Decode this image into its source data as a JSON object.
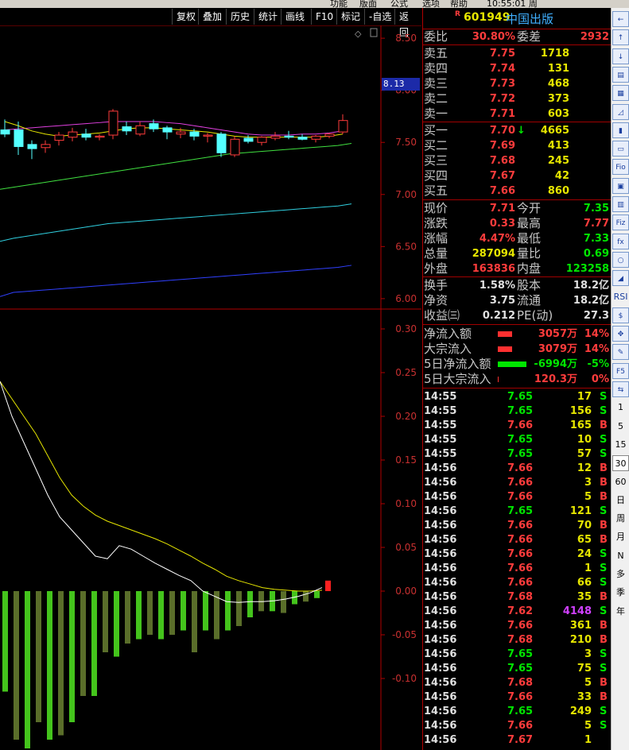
{
  "top_menu": [
    "功能",
    "版面",
    "公式",
    "选项",
    "帮助",
    "10:55:01 周"
  ],
  "toolbar": [
    {
      "label": "复权"
    },
    {
      "label": "叠加"
    },
    {
      "label": "历史"
    },
    {
      "label": "统计"
    },
    {
      "label": "画线"
    },
    {
      "label": "F10"
    },
    {
      "label": "标记"
    },
    {
      "label": "-自选"
    },
    {
      "label": "返回"
    }
  ],
  "price_tag": "8.13",
  "chart_data": [
    {
      "type": "candlestick",
      "ytick_labels": [
        "8.50",
        "8.00",
        "7.50",
        "7.00",
        "6.50",
        "6.00"
      ],
      "ylim": [
        5.9,
        8.6
      ],
      "candles": [
        {
          "o": 7.62,
          "h": 7.72,
          "l": 7.55,
          "c": 7.58
        },
        {
          "o": 7.62,
          "h": 7.7,
          "l": 7.38,
          "c": 7.46
        },
        {
          "o": 7.48,
          "h": 7.52,
          "l": 7.34,
          "c": 7.44
        },
        {
          "o": 7.45,
          "h": 7.52,
          "l": 7.4,
          "c": 7.48
        },
        {
          "o": 7.52,
          "h": 7.6,
          "l": 7.47,
          "c": 7.57
        },
        {
          "o": 7.55,
          "h": 7.64,
          "l": 7.51,
          "c": 7.6
        },
        {
          "o": 7.58,
          "h": 7.63,
          "l": 7.52,
          "c": 7.55
        },
        {
          "o": 7.55,
          "h": 7.58,
          "l": 7.52,
          "c": 7.56
        },
        {
          "o": 7.57,
          "h": 7.82,
          "l": 7.53,
          "c": 7.8
        },
        {
          "o": 7.65,
          "h": 7.7,
          "l": 7.57,
          "c": 7.61
        },
        {
          "o": 7.58,
          "h": 7.7,
          "l": 7.56,
          "c": 7.66
        },
        {
          "o": 7.68,
          "h": 7.72,
          "l": 7.6,
          "c": 7.63
        },
        {
          "o": 7.64,
          "h": 7.66,
          "l": 7.53,
          "c": 7.6
        },
        {
          "o": 7.58,
          "h": 7.64,
          "l": 7.54,
          "c": 7.6
        },
        {
          "o": 7.6,
          "h": 7.63,
          "l": 7.52,
          "c": 7.56
        },
        {
          "o": 7.56,
          "h": 7.59,
          "l": 7.5,
          "c": 7.57
        },
        {
          "o": 7.58,
          "h": 7.6,
          "l": 7.36,
          "c": 7.4
        },
        {
          "o": 7.38,
          "h": 7.56,
          "l": 7.36,
          "c": 7.53
        },
        {
          "o": 7.54,
          "h": 7.57,
          "l": 7.49,
          "c": 7.51
        },
        {
          "o": 7.5,
          "h": 7.56,
          "l": 7.47,
          "c": 7.55
        },
        {
          "o": 7.54,
          "h": 7.6,
          "l": 7.52,
          "c": 7.56
        },
        {
          "o": 7.56,
          "h": 7.61,
          "l": 7.53,
          "c": 7.55
        },
        {
          "o": 7.55,
          "h": 7.58,
          "l": 7.52,
          "c": 7.53
        },
        {
          "o": 7.53,
          "h": 7.57,
          "l": 7.5,
          "c": 7.56
        },
        {
          "o": 7.56,
          "h": 7.59,
          "l": 7.54,
          "c": 7.58
        },
        {
          "o": 7.6,
          "h": 7.77,
          "l": 7.58,
          "c": 7.71
        }
      ],
      "ma_short": [
        7.7,
        7.66,
        7.61,
        7.58,
        7.56,
        7.57,
        7.58,
        7.59,
        7.61,
        7.63,
        7.64,
        7.64,
        7.63,
        7.62,
        7.61,
        7.6,
        7.58,
        7.56,
        7.55,
        7.55,
        7.55,
        7.55,
        7.55,
        7.55,
        7.56,
        7.58
      ],
      "ma_mid": [
        7.62,
        7.63,
        7.64,
        7.65,
        7.66,
        7.67,
        7.68,
        7.69,
        7.7,
        7.7,
        7.7,
        7.7,
        7.69,
        7.68,
        7.66,
        7.64,
        7.62,
        7.6,
        7.58,
        7.57,
        7.57,
        7.57,
        7.58,
        7.58,
        7.59,
        7.61
      ],
      "ma_long": [
        7.07,
        7.09,
        7.11,
        7.13,
        7.15,
        7.17,
        7.19,
        7.21,
        7.23,
        7.25,
        7.27,
        7.29,
        7.31,
        7.33,
        7.35,
        7.37,
        7.39,
        7.4,
        7.41,
        7.42,
        7.43,
        7.44,
        7.45,
        7.46,
        7.47,
        7.49
      ],
      "ma_120": [
        6.58,
        6.6,
        6.62,
        6.64,
        6.66,
        6.68,
        6.7,
        6.72,
        6.73,
        6.74,
        6.75,
        6.76,
        6.77,
        6.78,
        6.79,
        6.8,
        6.81,
        6.82,
        6.83,
        6.84,
        6.85,
        6.86,
        6.87,
        6.88,
        6.89,
        6.91
      ],
      "ma_250": [
        6.06,
        6.07,
        6.08,
        6.09,
        6.1,
        6.11,
        6.12,
        6.13,
        6.14,
        6.15,
        6.16,
        6.17,
        6.18,
        6.19,
        6.2,
        6.21,
        6.22,
        6.23,
        6.24,
        6.25,
        6.26,
        6.27,
        6.28,
        6.29,
        6.3,
        6.32
      ]
    },
    {
      "type": "bar",
      "ytick_labels": [
        "0.30",
        "0.25",
        "0.20",
        "0.15",
        "0.10",
        "0.05",
        "0.00",
        "-0.05",
        "-0.10"
      ],
      "ylim": [
        -0.18,
        0.32
      ],
      "values": [
        -0.115,
        -0.17,
        -0.18,
        -0.15,
        -0.17,
        -0.165,
        -0.15,
        -0.12,
        -0.12,
        -0.07,
        -0.075,
        -0.06,
        -0.055,
        -0.05,
        -0.055,
        -0.05,
        -0.045,
        -0.07,
        -0.045,
        -0.055,
        -0.045,
        -0.04,
        -0.03,
        -0.023,
        -0.023,
        -0.025,
        -0.015,
        -0.012,
        -0.008,
        0.012
      ],
      "dif": [
        0.24,
        0.2,
        0.17,
        0.14,
        0.11,
        0.085,
        0.07,
        0.055,
        0.04,
        0.037,
        0.052,
        0.048,
        0.04,
        0.032,
        0.025,
        0.018,
        0.012,
        0.0,
        -0.006,
        -0.012,
        -0.013,
        -0.012,
        -0.012,
        -0.011,
        -0.009,
        -0.006,
        -0.002,
        0.004
      ],
      "dea": [
        0.24,
        0.22,
        0.2,
        0.18,
        0.155,
        0.13,
        0.11,
        0.097,
        0.087,
        0.08,
        0.075,
        0.07,
        0.065,
        0.06,
        0.054,
        0.047,
        0.04,
        0.032,
        0.025,
        0.017,
        0.012,
        0.008,
        0.004,
        0.002,
        0.001,
        0.0,
        0.0,
        0.001
      ]
    }
  ],
  "stock": {
    "flag": "R",
    "code": "601949",
    "name": "中国出版"
  },
  "wei": {
    "ratio_label": "委比",
    "ratio": "30.80%",
    "diff_label": "委差",
    "diff": "2932"
  },
  "sell": [
    {
      "label": "卖五",
      "price": "7.75",
      "vol": "1718"
    },
    {
      "label": "卖四",
      "price": "7.74",
      "vol": "131"
    },
    {
      "label": "卖三",
      "price": "7.73",
      "vol": "468"
    },
    {
      "label": "卖二",
      "price": "7.72",
      "vol": "373"
    },
    {
      "label": "卖一",
      "price": "7.71",
      "vol": "603"
    }
  ],
  "buy": [
    {
      "label": "买一",
      "price": "7.70",
      "vol": "4665",
      "arrow": "↓"
    },
    {
      "label": "买二",
      "price": "7.69",
      "vol": "413",
      "arrow": ""
    },
    {
      "label": "买三",
      "price": "7.68",
      "vol": "245",
      "arrow": ""
    },
    {
      "label": "买四",
      "price": "7.67",
      "vol": "42",
      "arrow": ""
    },
    {
      "label": "买五",
      "price": "7.66",
      "vol": "860",
      "arrow": ""
    }
  ],
  "stats": [
    {
      "l1": "现价",
      "v1": "7.71",
      "c1": "red",
      "l2": "今开",
      "v2": "7.35",
      "c2": "green"
    },
    {
      "l1": "涨跌",
      "v1": "0.33",
      "c1": "red",
      "l2": "最高",
      "v2": "7.77",
      "c2": "red"
    },
    {
      "l1": "涨幅",
      "v1": "4.47%",
      "c1": "red",
      "l2": "最低",
      "v2": "7.33",
      "c2": "green"
    },
    {
      "l1": "总量",
      "v1": "287094",
      "c1": "yellow",
      "l2": "量比",
      "v2": "0.69",
      "c2": "green"
    },
    {
      "l1": "外盘",
      "v1": "163836",
      "c1": "red",
      "l2": "内盘",
      "v2": "123258",
      "c2": "green"
    }
  ],
  "stats2": [
    {
      "l1": "换手",
      "v1": "1.58%",
      "l2": "股本",
      "v2": "18.2亿"
    },
    {
      "l1": "净资",
      "v1": "3.75",
      "l2": "流通",
      "v2": "18.2亿"
    },
    {
      "l1": "收益㈢",
      "v1": "0.212",
      "l2": "PE(动)",
      "v2": "27.3"
    }
  ],
  "flows": [
    {
      "label": "净流入额",
      "value": "3057万",
      "pct": "14%",
      "color": "red",
      "bar": 18
    },
    {
      "label": "大宗流入",
      "value": "3079万",
      "pct": "14%",
      "color": "red",
      "bar": 18
    },
    {
      "label": "5日净流入额",
      "value": "-6994万",
      "pct": "-5%",
      "color": "green",
      "bar": 36
    },
    {
      "label": "5日大宗流入",
      "value": "120.3万",
      "pct": "0%",
      "color": "red",
      "bar": 1
    }
  ],
  "ticks": [
    {
      "t": "14:55",
      "p": "7.65",
      "pc": "green",
      "v": "17",
      "vc": "yellow",
      "bs": "S"
    },
    {
      "t": "14:55",
      "p": "7.65",
      "pc": "green",
      "v": "156",
      "vc": "yellow",
      "bs": "S"
    },
    {
      "t": "14:55",
      "p": "7.66",
      "pc": "red",
      "v": "165",
      "vc": "yellow",
      "bs": "B"
    },
    {
      "t": "14:55",
      "p": "7.65",
      "pc": "green",
      "v": "10",
      "vc": "yellow",
      "bs": "S"
    },
    {
      "t": "14:55",
      "p": "7.65",
      "pc": "green",
      "v": "57",
      "vc": "yellow",
      "bs": "S"
    },
    {
      "t": "14:56",
      "p": "7.66",
      "pc": "red",
      "v": "12",
      "vc": "yellow",
      "bs": "B"
    },
    {
      "t": "14:56",
      "p": "7.66",
      "pc": "red",
      "v": "3",
      "vc": "yellow",
      "bs": "B"
    },
    {
      "t": "14:56",
      "p": "7.66",
      "pc": "red",
      "v": "5",
      "vc": "yellow",
      "bs": "B"
    },
    {
      "t": "14:56",
      "p": "7.65",
      "pc": "green",
      "v": "121",
      "vc": "yellow",
      "bs": "S"
    },
    {
      "t": "14:56",
      "p": "7.66",
      "pc": "red",
      "v": "70",
      "vc": "yellow",
      "bs": "B"
    },
    {
      "t": "14:56",
      "p": "7.66",
      "pc": "red",
      "v": "65",
      "vc": "yellow",
      "bs": "B"
    },
    {
      "t": "14:56",
      "p": "7.66",
      "pc": "red",
      "v": "24",
      "vc": "yellow",
      "bs": "S"
    },
    {
      "t": "14:56",
      "p": "7.66",
      "pc": "red",
      "v": "1",
      "vc": "yellow",
      "bs": "S"
    },
    {
      "t": "14:56",
      "p": "7.66",
      "pc": "red",
      "v": "66",
      "vc": "yellow",
      "bs": "S"
    },
    {
      "t": "14:56",
      "p": "7.68",
      "pc": "red",
      "v": "35",
      "vc": "yellow",
      "bs": "B"
    },
    {
      "t": "14:56",
      "p": "7.62",
      "pc": "red",
      "v": "4148",
      "vc": "purple",
      "bs": "S"
    },
    {
      "t": "14:56",
      "p": "7.66",
      "pc": "red",
      "v": "361",
      "vc": "yellow",
      "bs": "B"
    },
    {
      "t": "14:56",
      "p": "7.68",
      "pc": "red",
      "v": "210",
      "vc": "yellow",
      "bs": "B"
    },
    {
      "t": "14:56",
      "p": "7.65",
      "pc": "green",
      "v": "3",
      "vc": "yellow",
      "bs": "S"
    },
    {
      "t": "14:56",
      "p": "7.65",
      "pc": "green",
      "v": "75",
      "vc": "yellow",
      "bs": "S"
    },
    {
      "t": "14:56",
      "p": "7.68",
      "pc": "red",
      "v": "5",
      "vc": "yellow",
      "bs": "B"
    },
    {
      "t": "14:56",
      "p": "7.66",
      "pc": "red",
      "v": "33",
      "vc": "yellow",
      "bs": "B"
    },
    {
      "t": "14:56",
      "p": "7.65",
      "pc": "green",
      "v": "249",
      "vc": "yellow",
      "bs": "S"
    },
    {
      "t": "14:56",
      "p": "7.66",
      "pc": "red",
      "v": "5",
      "vc": "yellow",
      "bs": "S"
    },
    {
      "t": "14:56",
      "p": "7.67",
      "pc": "red",
      "v": "1",
      "vc": "yellow",
      "bs": ""
    }
  ],
  "right_tools": [
    {
      "kind": "icon",
      "label": "←"
    },
    {
      "kind": "icon",
      "label": "↑"
    },
    {
      "kind": "icon",
      "label": "↓"
    },
    {
      "kind": "icon",
      "label": "▤"
    },
    {
      "kind": "icon",
      "label": "▦"
    },
    {
      "kind": "icon",
      "label": "◿"
    },
    {
      "kind": "icon",
      "label": "▮"
    },
    {
      "kind": "icon",
      "label": "▭"
    },
    {
      "kind": "icon",
      "label": "Fio"
    },
    {
      "kind": "icon",
      "label": "▣"
    },
    {
      "kind": "icon",
      "label": "▥"
    },
    {
      "kind": "icon",
      "label": "Fiz"
    },
    {
      "kind": "icon",
      "label": "fx"
    },
    {
      "kind": "icon",
      "label": "○"
    },
    {
      "kind": "icon",
      "label": "◢"
    },
    {
      "kind": "text",
      "label": "RSI"
    },
    {
      "kind": "icon",
      "label": "$"
    },
    {
      "kind": "icon",
      "label": "✥"
    },
    {
      "kind": "icon",
      "label": "✎"
    },
    {
      "kind": "icon",
      "label": "F5"
    },
    {
      "kind": "icon",
      "label": "⇆"
    },
    {
      "kind": "text",
      "label": "1"
    },
    {
      "kind": "text",
      "label": "5"
    },
    {
      "kind": "text",
      "label": "15"
    },
    {
      "kind": "sel",
      "label": "30"
    },
    {
      "kind": "text",
      "label": "60"
    },
    {
      "kind": "text",
      "label": "日"
    },
    {
      "kind": "text",
      "label": "周"
    },
    {
      "kind": "text",
      "label": "月"
    },
    {
      "kind": "text",
      "label": "N"
    },
    {
      "kind": "text",
      "label": "多"
    },
    {
      "kind": "text",
      "label": "季"
    },
    {
      "kind": "text",
      "label": "年"
    }
  ],
  "colors": {
    "up": "#ff3c3c",
    "down": "#54ffff",
    "ma_short": "#ffffff",
    "ma_mid": "#e040e0",
    "ma_long": "#40e040",
    "ma_120": "#30d0e0",
    "ma_250": "#3040ff",
    "macd_pos": "#ff2020",
    "macd_neg_light": "#44c41c",
    "macd_neg_dark": "#5a6e2a",
    "dif": "#ffffff",
    "dea": "#e6e600",
    "axis": "#b00000"
  }
}
